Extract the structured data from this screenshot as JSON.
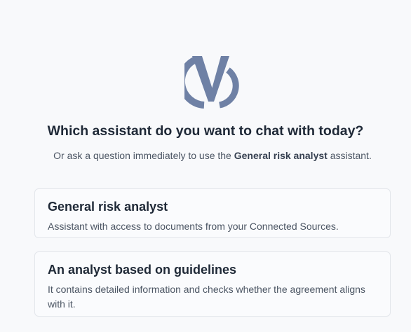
{
  "brand": {
    "logo_icon": "v-logo-icon",
    "logo_color": "#6f81a5"
  },
  "heading": {
    "title": "Which assistant do you want to chat with today?",
    "subtitle_prefix": "Or ask a question immediately to use the ",
    "subtitle_highlight": "General risk analyst",
    "subtitle_suffix": " assistant."
  },
  "assistants": [
    {
      "name": "General risk analyst",
      "description": "Assistant with access to documents from your Connected Sources."
    },
    {
      "name": "An analyst based on guidelines",
      "description": "It contains detailed information and checks whether the agreement aligns with it."
    }
  ]
}
